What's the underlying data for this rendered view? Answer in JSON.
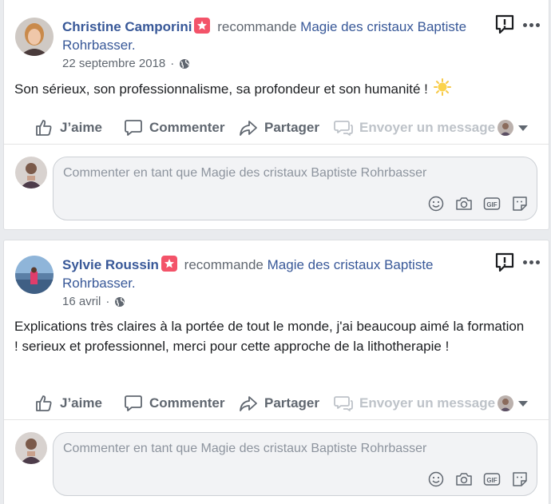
{
  "posts": [
    {
      "author": "Christine Camporini",
      "recommends": "recommande",
      "page_line1": "Magie des cristaux Baptiste",
      "page_line2": "Rohrbasser.",
      "date": "22 septembre 2018",
      "body": "Son sérieux, son professionnalisme, sa profondeur et son humanité !",
      "body_emoji": "sun-icon"
    },
    {
      "author": "Sylvie Roussin",
      "recommends": "recommande",
      "page_line1": "Magie des cristaux Baptiste",
      "page_line2": "Rohrbasser.",
      "date": "16 avril",
      "body": "Explications très claires à la portée de tout le monde, j'ai beaucoup aimé la formation ! serieux et professionnel, merci pour cette approche de la lithotherapie !"
    }
  ],
  "actions": {
    "like": "J’aime",
    "comment": "Commenter",
    "share": "Partager",
    "message": "Envoyer un message"
  },
  "composer": {
    "placeholder": "Commenter en tant que Magie des cristaux Baptiste Rohrbasser",
    "tools": [
      "emoji-icon",
      "camera-icon",
      "gif-icon",
      "sticker-icon"
    ]
  },
  "colors": {
    "link": "#385898",
    "muted": "#606770",
    "badge": "#f35369",
    "disabled": "#bec3c9",
    "background": "#e9ebee"
  }
}
